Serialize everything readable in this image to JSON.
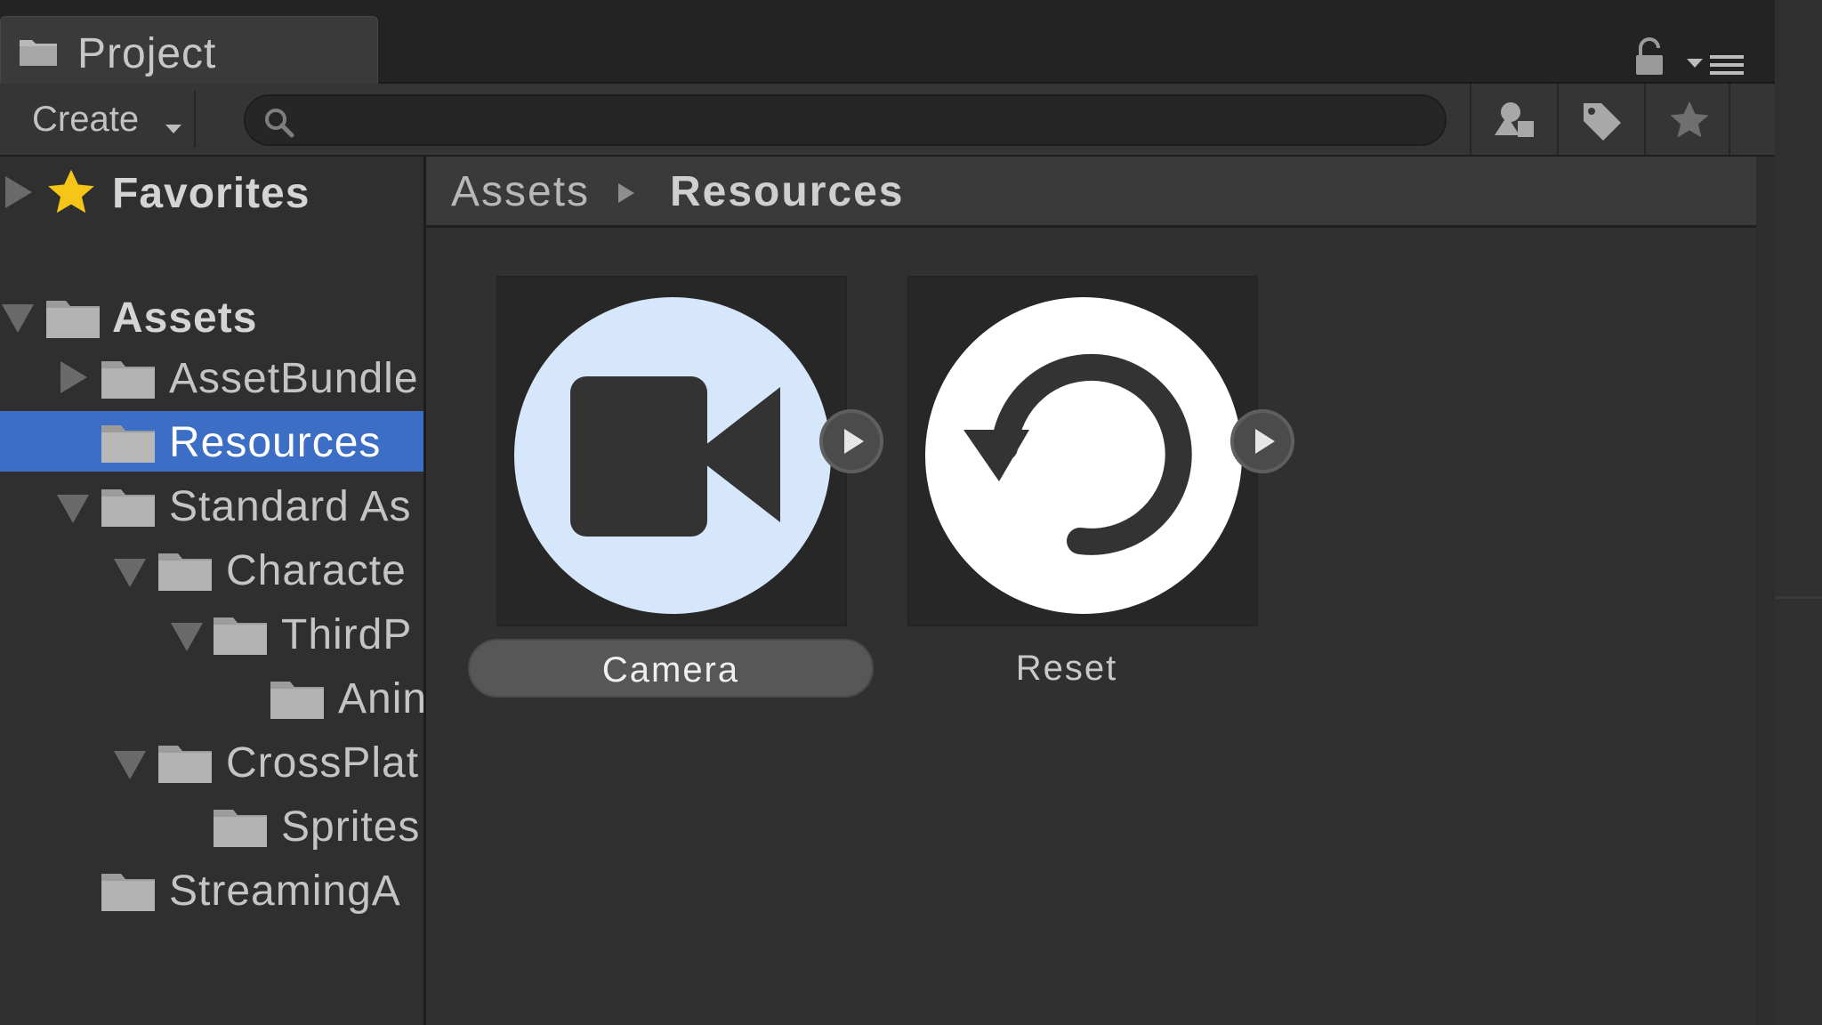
{
  "window": {
    "tab_title": "Project"
  },
  "toolbar": {
    "create_label": "Create",
    "search_placeholder": "",
    "search_value": ""
  },
  "tree": {
    "favorites_label": "Favorites",
    "assets_label": "Assets",
    "items": [
      {
        "label": "AssetBundle",
        "expanded": false
      },
      {
        "label": "Resources",
        "selected": true
      },
      {
        "label": "Standard As",
        "expanded": true
      },
      {
        "label": "Characte",
        "expanded": true
      },
      {
        "label": "ThirdP",
        "expanded": true
      },
      {
        "label": "Anin"
      },
      {
        "label": "CrossPlat",
        "expanded": true
      },
      {
        "label": "Sprites"
      },
      {
        "label": "StreamingA"
      }
    ]
  },
  "breadcrumb": {
    "root": "Assets",
    "current": "Resources"
  },
  "assets": [
    {
      "label": "Camera",
      "icon": "camera-icon",
      "selected": true
    },
    {
      "label": "Reset",
      "icon": "reset-icon",
      "selected": false
    }
  ],
  "colors": {
    "selection": "#3d6ec5",
    "background": "#2d2d2d",
    "favorite_star": "#f5c518",
    "camera_icon_bg": "#d6e6fb"
  },
  "icons": {
    "tab": "folder-icon",
    "lock": "lock-icon",
    "menu": "menu-icon",
    "search": "search-icon",
    "type_filter": "type-filter-icon",
    "label_filter": "label-filter-icon",
    "favorite": "favorite-star-icon"
  }
}
